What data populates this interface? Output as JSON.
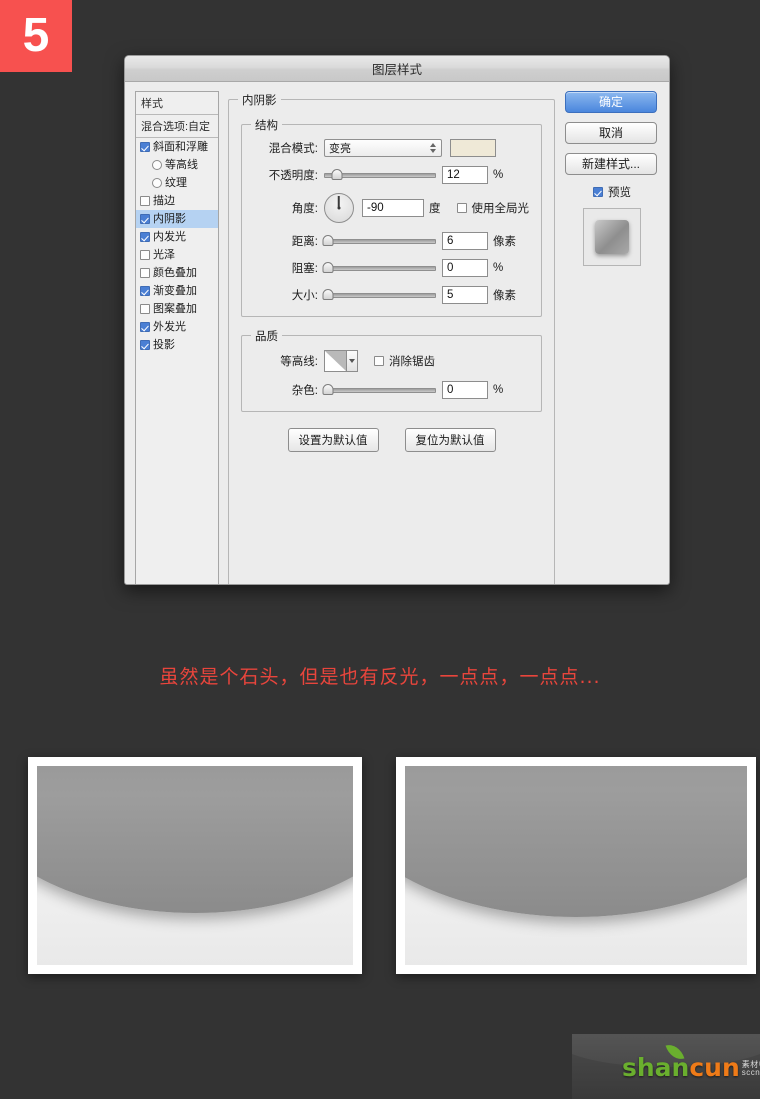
{
  "step": {
    "number": "5"
  },
  "dialog": {
    "title": "图层样式",
    "styles_panel": {
      "header": "样式",
      "blending_options": "混合选项:自定",
      "items": [
        {
          "label": "斜面和浮雕",
          "checked": true,
          "sub": false,
          "selected": false,
          "radio": false
        },
        {
          "label": "等高线",
          "checked": false,
          "sub": true,
          "selected": false,
          "radio": true
        },
        {
          "label": "纹理",
          "checked": false,
          "sub": true,
          "selected": false,
          "radio": true
        },
        {
          "label": "描边",
          "checked": false,
          "sub": false,
          "selected": false,
          "radio": false
        },
        {
          "label": "内阴影",
          "checked": true,
          "sub": false,
          "selected": true,
          "radio": false
        },
        {
          "label": "内发光",
          "checked": true,
          "sub": false,
          "selected": false,
          "radio": false
        },
        {
          "label": "光泽",
          "checked": false,
          "sub": false,
          "selected": false,
          "radio": false
        },
        {
          "label": "颜色叠加",
          "checked": false,
          "sub": false,
          "selected": false,
          "radio": false
        },
        {
          "label": "渐变叠加",
          "checked": true,
          "sub": false,
          "selected": false,
          "radio": false
        },
        {
          "label": "图案叠加",
          "checked": false,
          "sub": false,
          "selected": false,
          "radio": false
        },
        {
          "label": "外发光",
          "checked": true,
          "sub": false,
          "selected": false,
          "radio": false
        },
        {
          "label": "投影",
          "checked": true,
          "sub": false,
          "selected": false,
          "radio": false
        }
      ]
    },
    "effect": {
      "title": "内阴影",
      "structure": {
        "legend": "结构",
        "blend_mode_label": "混合模式:",
        "blend_mode_value": "变亮",
        "blend_color": "#efe9d7",
        "opacity_label": "不透明度:",
        "opacity_value": "12",
        "opacity_unit": "%",
        "opacity_percent": 12,
        "angle_label": "角度:",
        "angle_value": "-90",
        "angle_unit": "度",
        "angle_degrees": -90,
        "use_global_light_label": "使用全局光",
        "use_global_light_checked": false,
        "distance_label": "距离:",
        "distance_value": "6",
        "distance_unit": "像素",
        "distance_percent": 4,
        "choke_label": "阻塞:",
        "choke_value": "0",
        "choke_unit": "%",
        "choke_percent": 0,
        "size_label": "大小:",
        "size_value": "5",
        "size_unit": "像素",
        "size_percent": 3
      },
      "quality": {
        "legend": "品质",
        "contour_label": "等高线:",
        "anti_alias_label": "消除锯齿",
        "anti_alias_checked": false,
        "noise_label": "杂色:",
        "noise_value": "0",
        "noise_unit": "%",
        "noise_percent": 0
      },
      "set_default_button": "设置为默认值",
      "reset_default_button": "复位为默认值"
    },
    "actions": {
      "ok": "确定",
      "cancel": "取消",
      "new_style": "新建样式...",
      "preview_label": "预览",
      "preview_checked": true
    }
  },
  "caption": "虽然是个石头，但是也有反光，一点点，一点点...",
  "watermark": {
    "part1": "shan",
    "part2": "cun",
    "suffix": "素材中国\\nsccnn.com"
  },
  "colors": {
    "background": "#333333",
    "badge": "#f7514f",
    "caption": "#e8453c",
    "accent_blue": "#4a86dd",
    "selection": "#b5d2f2"
  }
}
